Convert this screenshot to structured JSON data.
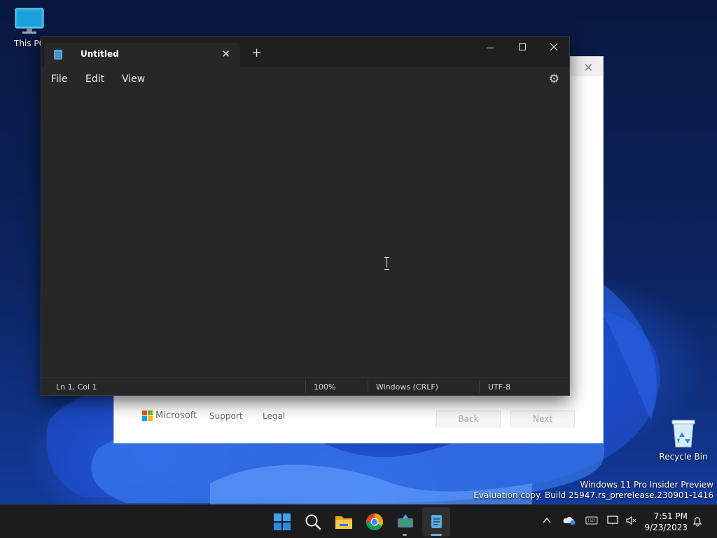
{
  "desktop": {
    "icons": [
      {
        "label": "This PC",
        "icon": "monitor-icon"
      },
      {
        "label": "Recycle Bin",
        "icon": "recycle-bin-icon"
      }
    ],
    "watermark": {
      "line1": "Windows 11 Pro Insider Preview",
      "line2": "Evaluation copy. Build 25947.rs_prerelease.230901-1416"
    }
  },
  "setup_window": {
    "brand": "Microsoft",
    "links": [
      "Support",
      "Legal"
    ],
    "buttons": [
      "Back",
      "Next"
    ],
    "close_glyph": "✕"
  },
  "notepad": {
    "tab_title": "Untitled",
    "menu": [
      "File",
      "Edit",
      "View"
    ],
    "window_controls": [
      "minimize-icon",
      "maximize-icon",
      "close-icon"
    ],
    "status": {
      "position": "Ln 1, Col 1",
      "zoom": "100%",
      "line_ending": "Windows (CRLF)",
      "encoding": "UTF-8"
    },
    "colors": {
      "background": "#272727",
      "titlebar": "#1f1f1f",
      "accent": "#5aa8e0"
    }
  },
  "taskbar": {
    "apps": [
      "start-icon",
      "search-icon",
      "file-explorer-icon",
      "chrome-icon",
      "setup-app-icon",
      "notepad-icon"
    ],
    "tray": [
      "chevron-up-icon",
      "onedrive-icon",
      "keyboard-icon",
      "display-icon",
      "volume-muted-icon",
      "notification-bell-icon"
    ],
    "time": "7:51 PM",
    "date": "9/23/2023"
  }
}
